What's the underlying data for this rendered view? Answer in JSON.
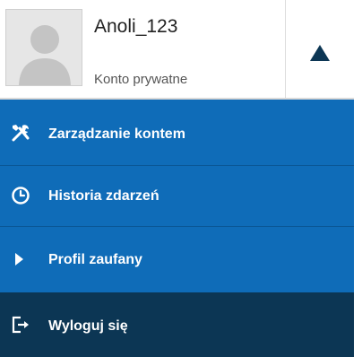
{
  "user": {
    "name": "Anoli_123",
    "account_type": "Konto prywatne",
    "avatar_icon": "user-avatar-placeholder-icon",
    "toggle_icon": "caret-up-icon"
  },
  "menu": {
    "items": [
      {
        "label": "Zarządzanie kontem",
        "icon": "tools-icon"
      },
      {
        "label": "Historia zdarzeń",
        "icon": "clock-icon"
      },
      {
        "label": "Profil zaufany",
        "icon": "play-arrow-icon"
      }
    ],
    "logout": {
      "label": "Wyloguj się",
      "icon": "logout-icon"
    }
  },
  "colors": {
    "menu_blue": "#0f6cb8",
    "logout_dark": "#0c3654",
    "toggle_arrow": "#0c3654"
  }
}
